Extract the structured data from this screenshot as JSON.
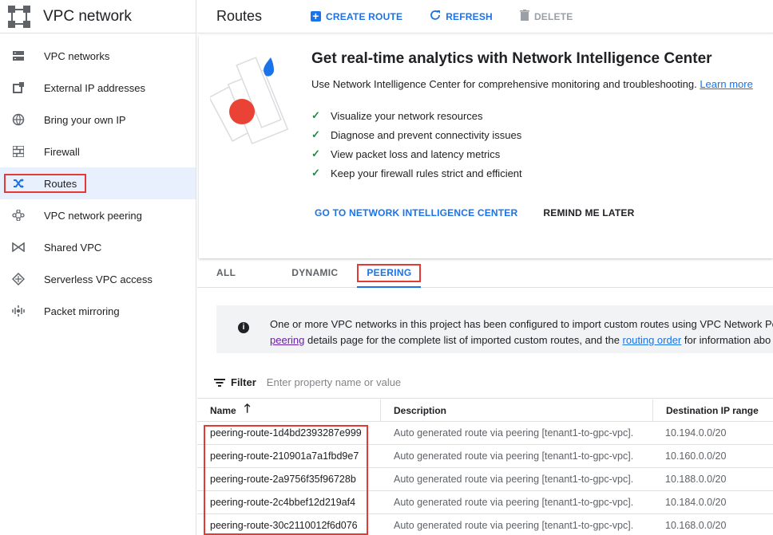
{
  "sidebar": {
    "title": "VPC network",
    "items": [
      {
        "label": "VPC networks",
        "icon": "vpc-networks-icon"
      },
      {
        "label": "External IP addresses",
        "icon": "external-ip-icon"
      },
      {
        "label": "Bring your own IP",
        "icon": "globe-icon"
      },
      {
        "label": "Firewall",
        "icon": "firewall-icon"
      },
      {
        "label": "Routes",
        "icon": "routes-icon",
        "active": true
      },
      {
        "label": "VPC network peering",
        "icon": "peering-icon"
      },
      {
        "label": "Shared VPC",
        "icon": "shared-vpc-icon"
      },
      {
        "label": "Serverless VPC access",
        "icon": "serverless-icon"
      },
      {
        "label": "Packet mirroring",
        "icon": "packet-mirroring-icon"
      }
    ]
  },
  "toolbar": {
    "title": "Routes",
    "create_label": "CREATE ROUTE",
    "refresh_label": "REFRESH",
    "delete_label": "DELETE"
  },
  "promo": {
    "heading": "Get real-time analytics with Network Intelligence Center",
    "description": "Use Network Intelligence Center for comprehensive monitoring and troubleshooting.",
    "learn_more": "Learn more",
    "checks": [
      "Visualize your network resources",
      "Diagnose and prevent connectivity issues",
      "View packet loss and latency metrics",
      "Keep your firewall rules strict and efficient"
    ],
    "primary_action": "GO TO NETWORK INTELLIGENCE CENTER",
    "secondary_action": "REMIND ME LATER"
  },
  "tabs": {
    "all": "ALL",
    "dynamic": "DYNAMIC",
    "peering": "PEERING"
  },
  "info": {
    "line1": "One or more VPC networks in this project has been configured to import custom routes using VPC Network Pe",
    "line2_link1": "peering",
    "line2_mid": " details page for the complete list of imported custom routes, and the ",
    "line2_link2": "routing order",
    "line2_end": " for information abo"
  },
  "filter": {
    "label": "Filter",
    "placeholder": "Enter property name or value"
  },
  "table": {
    "headers": {
      "name": "Name",
      "description": "Description",
      "destination": "Destination IP range"
    },
    "rows": [
      {
        "name": "peering-route-1d4bd2393287e999",
        "description": "Auto generated route via peering [tenant1-to-gpc-vpc].",
        "destination": "10.194.0.0/20"
      },
      {
        "name": "peering-route-210901a7a1fbd9e7",
        "description": "Auto generated route via peering [tenant1-to-gpc-vpc].",
        "destination": "10.160.0.0/20"
      },
      {
        "name": "peering-route-2a9756f35f96728b",
        "description": "Auto generated route via peering [tenant1-to-gpc-vpc].",
        "destination": "10.188.0.0/20"
      },
      {
        "name": "peering-route-2c4bbef12d219af4",
        "description": "Auto generated route via peering [tenant1-to-gpc-vpc].",
        "destination": "10.184.0.0/20"
      },
      {
        "name": "peering-route-30c2110012f6d076",
        "description": "Auto generated route via peering [tenant1-to-gpc-vpc].",
        "destination": "10.168.0.0/20"
      }
    ]
  },
  "colors": {
    "accent": "#1a73e8",
    "highlight": "#e53935",
    "check": "#1e8e3e"
  }
}
